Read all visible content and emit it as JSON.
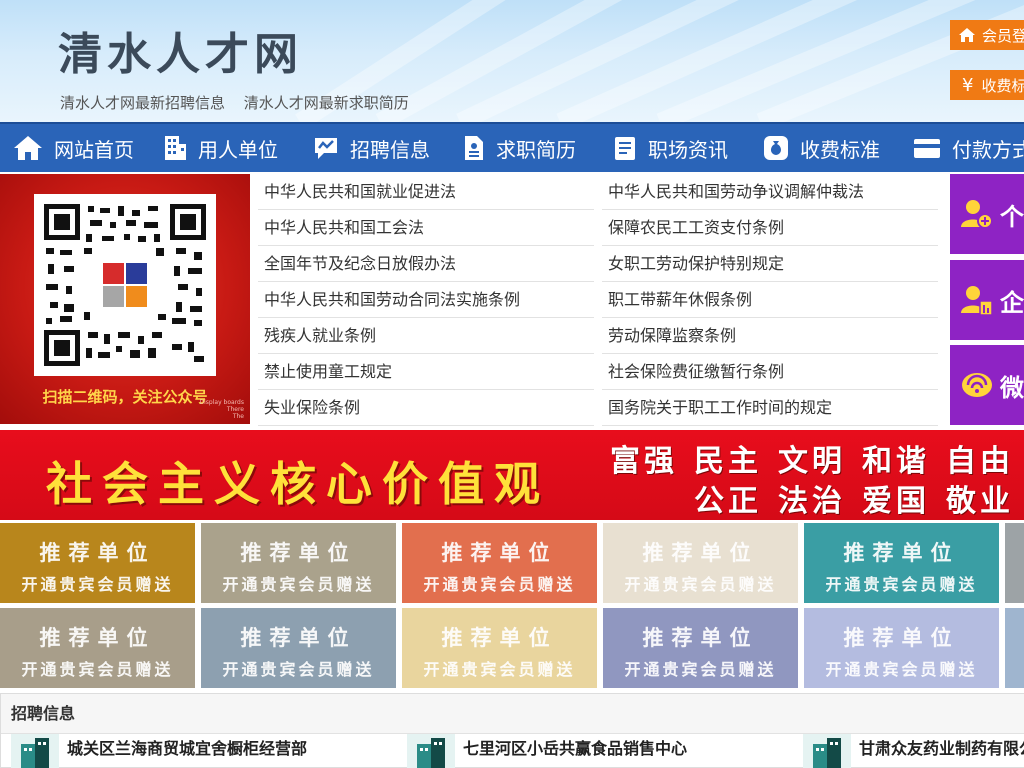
{
  "header": {
    "site_title": "清水人才网",
    "sub_links": [
      "清水人才网最新招聘信息",
      "清水人才网最新求职简历"
    ],
    "member_login": "会员登",
    "fee_standard": "收费标",
    "accent_color": "#f07a14"
  },
  "nav": [
    {
      "label": "网站首页",
      "icon": "home-icon"
    },
    {
      "label": "用人单位",
      "icon": "building-icon"
    },
    {
      "label": "招聘信息",
      "icon": "chat-icon"
    },
    {
      "label": "求职简历",
      "icon": "resume-icon"
    },
    {
      "label": "职场资讯",
      "icon": "news-icon"
    },
    {
      "label": "收费标准",
      "icon": "money-bag-icon"
    },
    {
      "label": "付款方式",
      "icon": "card-icon"
    }
  ],
  "qr_banner": {
    "caption": "扫描二维码，关注公众号",
    "small_text": [
      "Display boards",
      "There",
      "The"
    ]
  },
  "laws": {
    "left": [
      "中华人民共和国就业促进法",
      "中华人民共和国工会法",
      "全国年节及纪念日放假办法",
      "中华人民共和国劳动合同法实施条例",
      "残疾人就业条例",
      "禁止使用童工规定",
      "失业保险条例"
    ],
    "right": [
      "中华人民共和国劳动争议调解仲裁法",
      "保障农民工工资支付条例",
      "女职工劳动保护特别规定",
      "职工带薪年休假条例",
      "劳动保障监察条例",
      "社会保险费征缴暂行条例",
      "国务院关于职工工作时间的规定"
    ]
  },
  "side_tiles": [
    {
      "label": "个",
      "icon": "person-add-icon"
    },
    {
      "label": "企",
      "icon": "enterprise-user-icon"
    },
    {
      "label": "微",
      "icon": "wechat-icon"
    }
  ],
  "values_banner": {
    "title": "社会主义核心价值观",
    "row1": [
      "富强",
      "民主",
      "文明",
      "和谐",
      "自由"
    ],
    "row2": [
      "公正",
      "法治",
      "爱国",
      "敬业"
    ]
  },
  "recommend": {
    "line1": "推荐单位",
    "line2": "开通贵宾会员赠送",
    "colors_row1": [
      "#b8861c",
      "#aaa28c",
      "#e26f4e",
      "#e8e0d1",
      "#3a9ea4",
      "#9da3a6"
    ],
    "colors_row2": [
      "#a89e8a",
      "#8da0b0",
      "#e9d59e",
      "#9097c0",
      "#b4bce0",
      "#9fb5cf"
    ]
  },
  "recruit": {
    "heading": "招聘信息",
    "jobs": [
      "城关区兰海商贸城宜舍橱柜经营部",
      "七里河区小岳共赢食品销售中心",
      "甘肃众友药业制药有限公"
    ]
  }
}
